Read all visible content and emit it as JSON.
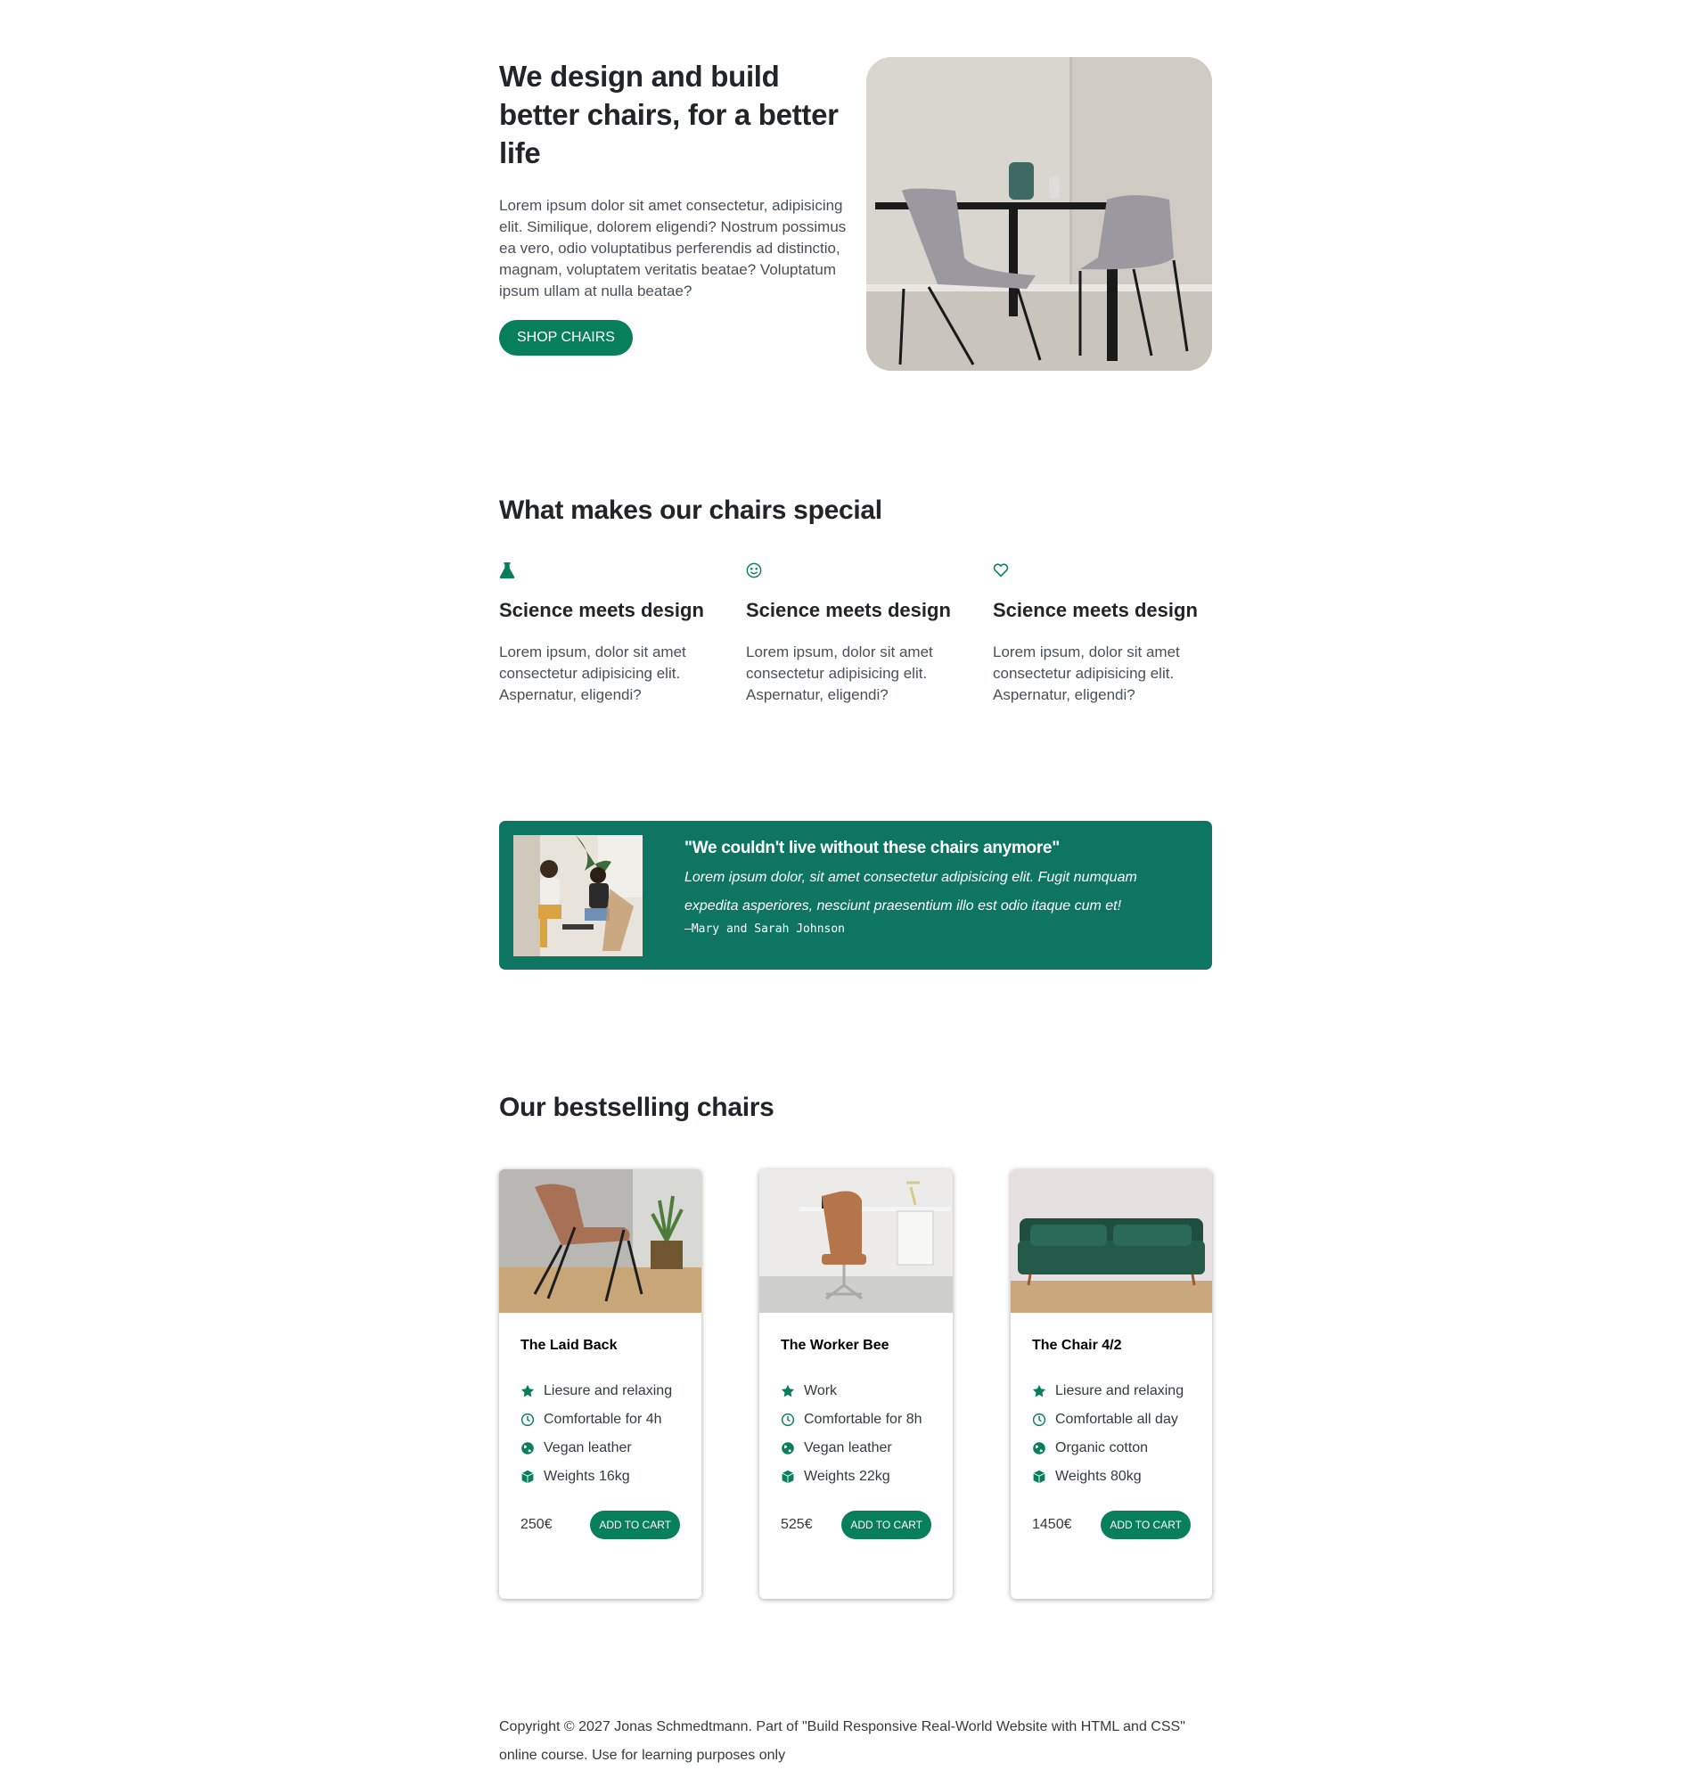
{
  "hero": {
    "title": "We design and build better chairs, for a better life",
    "description": "Lorem ipsum dolor sit amet consectetur, adipisicing elit. Similique, dolorem eligendi? Nostrum possimus ea vero, odio voluptatibus perferendis ad distinctio, magnam, voluptatem veritatis beatae? Voluptatum ipsum ullam at nulla beatae?",
    "cta_label": "Shop chairs"
  },
  "features": {
    "title": "What makes our chairs special",
    "items": [
      {
        "icon": "flask-icon",
        "title": "Science meets design",
        "text": "Lorem ipsum, dolor sit amet consectetur adipisicing elit. Aspernatur, eligendi?"
      },
      {
        "icon": "smile-icon",
        "title": "Science meets design",
        "text": "Lorem ipsum, dolor sit amet consectetur adipisicing elit. Aspernatur, eligendi?"
      },
      {
        "icon": "heart-icon",
        "title": "Science meets design",
        "text": "Lorem ipsum, dolor sit amet consectetur adipisicing elit. Aspernatur, eligendi?"
      }
    ]
  },
  "testimonial": {
    "title": "\"We couldn't live without these chairs anymore\"",
    "text": "Lorem ipsum dolor, sit amet consectetur adipisicing elit. Fugit numquam expedita asperiores, nesciunt praesentium illo est odio itaque cum et!",
    "author": "—Mary and Sarah Johnson"
  },
  "products": {
    "title": "Our bestselling chairs",
    "items": [
      {
        "name": "The Laid Back",
        "features": [
          "Liesure and relaxing",
          "Comfortable for 4h",
          "Vegan leather",
          "Weights 16kg"
        ],
        "price": "250€",
        "cart_label": "Add to cart"
      },
      {
        "name": "The Worker Bee",
        "features": [
          "Work",
          "Comfortable for 8h",
          "Vegan leather",
          "Weights 22kg"
        ],
        "price": "525€",
        "cart_label": "Add to cart"
      },
      {
        "name": "The Chair 4/2",
        "features": [
          "Liesure and relaxing",
          "Comfortable all day",
          "Organic cotton",
          "Weights 80kg"
        ],
        "price": "1450€",
        "cart_label": "Add to cart"
      }
    ],
    "feature_icons": [
      "star-icon",
      "clock-icon",
      "globe-icon",
      "box-icon"
    ]
  },
  "footer": {
    "copyright": "Copyright © 2027 Jonas Schmedtmann. Part of \"Build Responsive Real-World Website with HTML and CSS\" online course. Use for learning purposes only"
  },
  "colors": {
    "accent": "#087f5b",
    "testimonial_bg": "#0d7562",
    "text": "#343a40"
  }
}
